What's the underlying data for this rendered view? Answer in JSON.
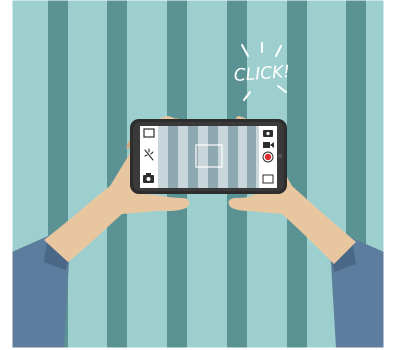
{
  "illustration": {
    "caption": "CLICK!"
  },
  "colors": {
    "background": "#9ecfcf",
    "stripe": "#5b9394",
    "skin": "#e8c6a0",
    "skin_shadow": "#d3a880",
    "sleeve": "#5c7d9e",
    "sleeve_dark": "#4b6886",
    "phone_body": "#2d2d2d",
    "screen": "#c9d6dc",
    "record_red": "#e02a2a"
  },
  "camera_ui": {
    "left_icons": [
      "gallery-icon",
      "flash-icon",
      "camera-icon"
    ],
    "right_icons": [
      "switch-camera-icon",
      "video-icon",
      "record-icon",
      "menu-icon"
    ]
  }
}
